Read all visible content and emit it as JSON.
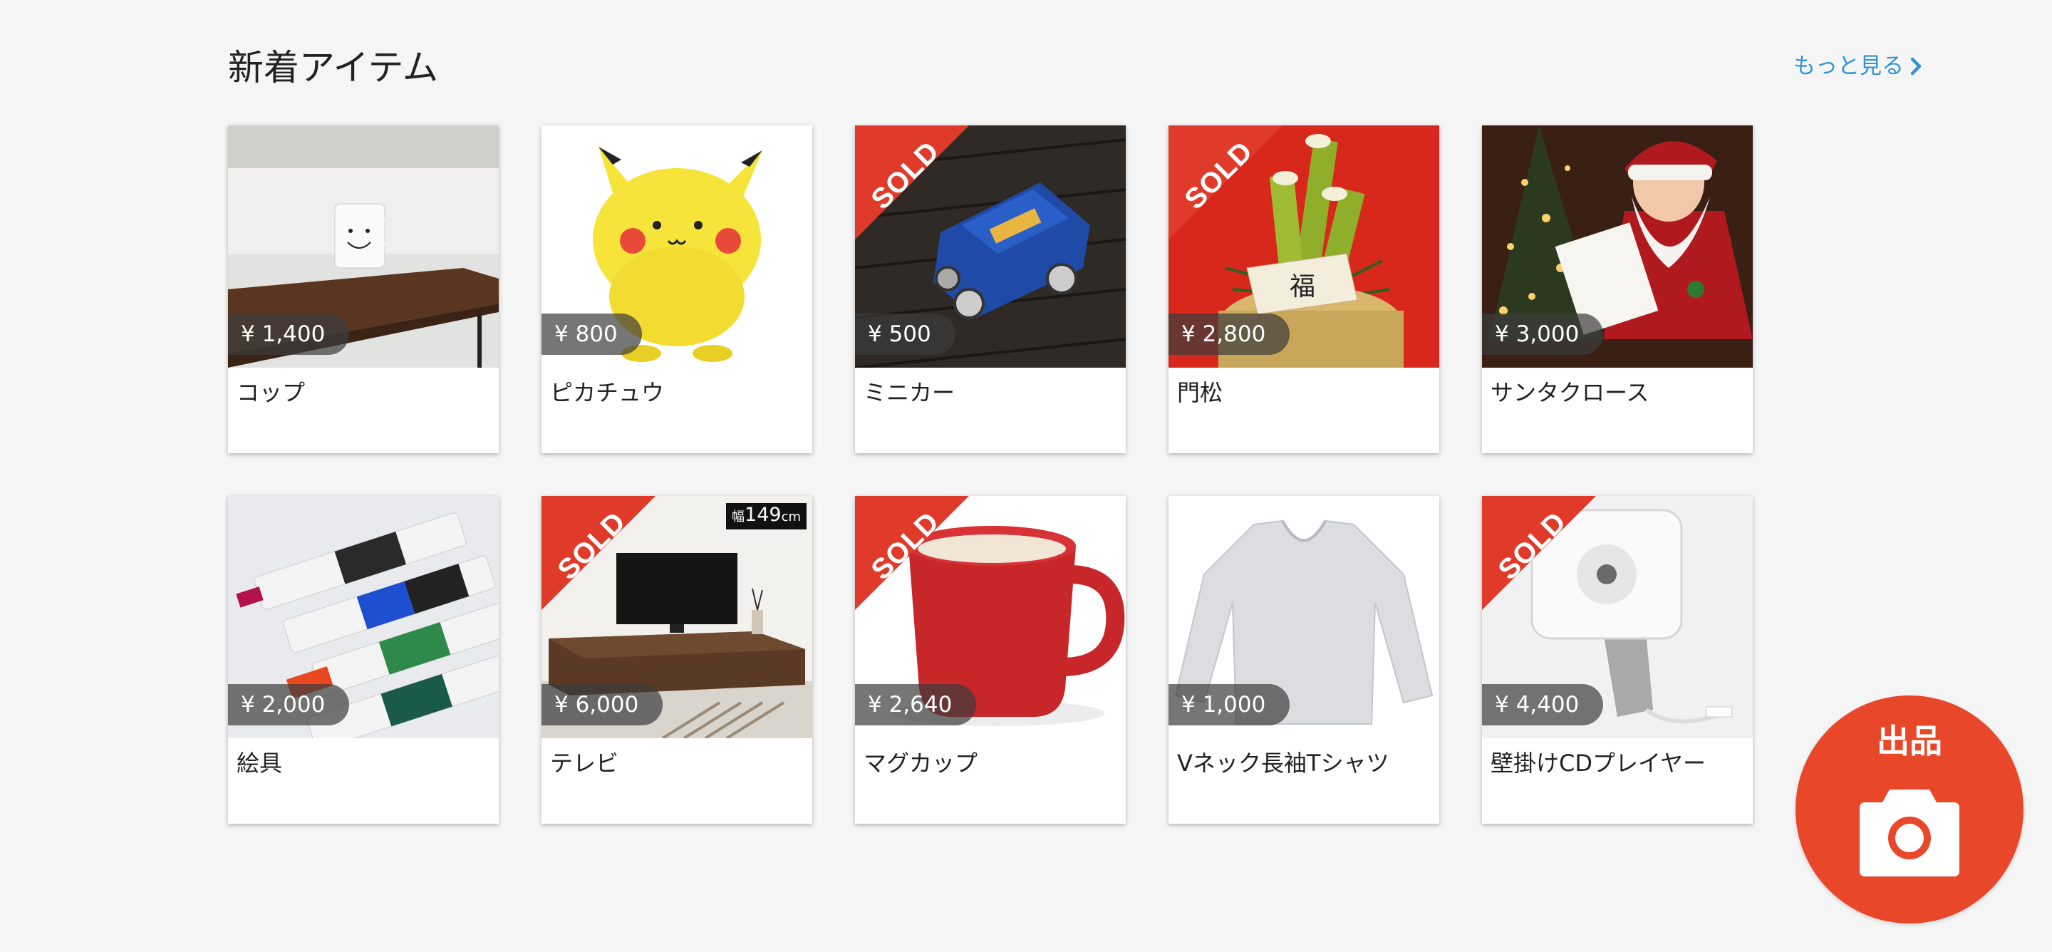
{
  "section": {
    "title": "新着アイテム",
    "more_label": "もっと見る"
  },
  "sold_label": "SOLD",
  "items": [
    {
      "name": "コップ",
      "price": "¥ 1,400",
      "sold": false
    },
    {
      "name": "ピカチュウ",
      "price": "¥ 800",
      "sold": false
    },
    {
      "name": "ミニカー",
      "price": "¥ 500",
      "sold": true
    },
    {
      "name": "門松",
      "price": "¥ 2,800",
      "sold": true
    },
    {
      "name": "サンタクロース",
      "price": "¥ 3,000",
      "sold": false
    },
    {
      "name": "絵具",
      "price": "¥ 2,000",
      "sold": false
    },
    {
      "name": "テレビ",
      "price": "¥ 6,000",
      "sold": true,
      "width_tag": {
        "prefix": "幅",
        "value": "149",
        "unit": "cm"
      }
    },
    {
      "name": "マグカップ",
      "price": "¥ 2,640",
      "sold": true
    },
    {
      "name": "Vネック長袖Tシャツ",
      "price": "¥ 1,000",
      "sold": false
    },
    {
      "name": "壁掛けCDプレイヤー",
      "price": "¥ 4,400",
      "sold": true
    }
  ],
  "sell_button": {
    "label": "出品",
    "icon": "camera-icon"
  },
  "colors": {
    "accent": "#e8472a",
    "link": "#2f95d6",
    "sold_banner": "#e03a2b",
    "background": "#f5f5f5"
  }
}
